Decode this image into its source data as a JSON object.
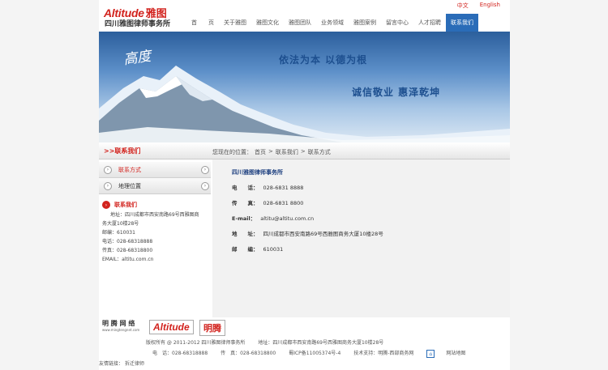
{
  "header": {
    "logo_en": "Altitude",
    "logo_cn": "雅图",
    "firm_name": "四川雅图律师事务所",
    "lang": [
      "中文",
      "English"
    ],
    "nav": [
      "首　　页",
      "关于雅图",
      "雅图文化",
      "雅图团队",
      "业务领域",
      "雅图案例",
      "留言中心",
      "人才招聘",
      "联系我们"
    ],
    "nav_active": 8
  },
  "banner": {
    "calligraphy": "高度",
    "slogan1": "依法为本 以德为根",
    "slogan2": "诚信敬业 惠泽乾坤"
  },
  "section": {
    "title": ">>联系我们",
    "breadcrumb": [
      "您现在的位置：",
      "首页",
      ">",
      "联系我们",
      ">",
      "联系方式"
    ]
  },
  "sidebar": {
    "items": [
      "联系方式",
      "地理位置"
    ],
    "active": 0,
    "contact_title": "联系我们",
    "contact_lines": [
      "地址：四川成都市西安南路69号西雅图商",
      "务大厦10楼28号",
      "邮编：610031",
      "电话：028-68318888",
      "传真：028-68318800",
      "EMAIL：altitu.com.cn"
    ]
  },
  "content": {
    "title": "四川雅图律师事务所",
    "rows": [
      {
        "label": "电　　话：",
        "value": "028-6831 8888"
      },
      {
        "label": "传　　真：",
        "value": "028-6831 8800"
      },
      {
        "label": "E-mail：",
        "value": "altitu@altitu.com.cn"
      },
      {
        "label": "地　　址：",
        "value": "四川成都市西安南路69号西雅图商务大厦10楼28号"
      },
      {
        "label": "邮　　编：",
        "value": "610031"
      }
    ]
  },
  "footer_logos": {
    "mingteng_net": "明 腾 网 络",
    "mingteng_url": "www.mingtengnet.com",
    "altitude": "Altitude",
    "mingteng": "明腾"
  },
  "footer": {
    "copyright": "版权所有 @ 2011-2012 四川雅图律师事务所",
    "address": "地址：四川成都市西安南路69号西雅图商务大厦10楼28号",
    "phone": "电　话：028-68318888",
    "fax": "传　真：028-68318800",
    "icp": "蜀ICP备11005374号-4",
    "tech": "技术支持：明腾-西部商务网",
    "sitemap": "网站地图",
    "links": "友情链接：",
    "links_item": "拆迁律师"
  },
  "colors": {
    "accent": "#d2231e",
    "nav_active": "#2a6cb8"
  }
}
